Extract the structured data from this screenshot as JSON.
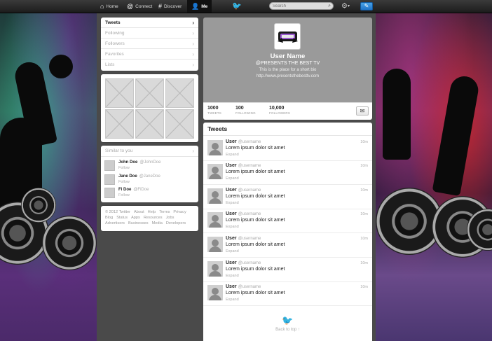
{
  "nav": {
    "home": "Home",
    "connect": "Connect",
    "discover": "Discover",
    "me": "Me",
    "search_placeholder": "Search"
  },
  "menu": {
    "items": [
      {
        "label": "Tweets"
      },
      {
        "label": "Following"
      },
      {
        "label": "Followers"
      },
      {
        "label": "Favorites"
      },
      {
        "label": "Lists"
      }
    ]
  },
  "similar": {
    "title": "Similar to you",
    "people": [
      {
        "name": "John Doe",
        "handle": "@JohnDoe",
        "action": "Follow"
      },
      {
        "name": "Jane Doe",
        "handle": "@JaneDoe",
        "action": "Follow"
      },
      {
        "name": "Fi Doe",
        "handle": "@FiDoe",
        "action": "Follow"
      }
    ]
  },
  "footer": {
    "links": [
      "© 2012 Twitter",
      "About",
      "Help",
      "Terms",
      "Privacy",
      "Blog",
      "Status",
      "Apps",
      "Resources",
      "Jobs",
      "Advertisers",
      "Businesses",
      "Media",
      "Developers"
    ]
  },
  "profile": {
    "name": "User Name",
    "handle": "@PRESENTS THE BEST TV",
    "bio": "This is the place for a short bio",
    "url": "http://www.presentsthebesttv.com",
    "stats": [
      {
        "value": "1000",
        "label": "TWEETS"
      },
      {
        "value": "100",
        "label": "FOLLOWING"
      },
      {
        "value": "10,000",
        "label": "FOLLOWERS"
      }
    ]
  },
  "tweets": {
    "title": "Tweets",
    "items": [
      {
        "name": "User",
        "handle": "@username",
        "text": "Lorem ipsum dolor sit amet",
        "expand": "Expand",
        "time": "10m"
      },
      {
        "name": "User",
        "handle": "@username",
        "text": "Lorem ipsum dolor sit amet",
        "expand": "Expand",
        "time": "10m"
      },
      {
        "name": "User",
        "handle": "@username",
        "text": "Lorem ipsum dolor sit amet",
        "expand": "Expand",
        "time": "10m"
      },
      {
        "name": "User",
        "handle": "@username",
        "text": "Lorem ipsum dolor sit amet",
        "expand": "Expand",
        "time": "10m"
      },
      {
        "name": "User",
        "handle": "@username",
        "text": "Lorem ipsum dolor sit amet",
        "expand": "Expand",
        "time": "10m"
      },
      {
        "name": "User",
        "handle": "@username",
        "text": "Lorem ipsum dolor sit amet",
        "expand": "Expand",
        "time": "10m"
      },
      {
        "name": "User",
        "handle": "@username",
        "text": "Lorem ipsum dolor sit amet",
        "expand": "Expand",
        "time": "10m"
      }
    ],
    "back_to_top": "Back to top ↑"
  },
  "colors": {
    "accent": "#1f74c9",
    "profile_header": "#9a9a9a",
    "topbar": "#1c1c1c"
  },
  "icons": {
    "home": "home-icon",
    "connect": "at-icon",
    "discover": "hash-icon",
    "me": "user-icon",
    "bird": "twitter-bird-icon",
    "settings": "gear-icon",
    "compose": "compose-icon",
    "message": "envelope-icon"
  }
}
